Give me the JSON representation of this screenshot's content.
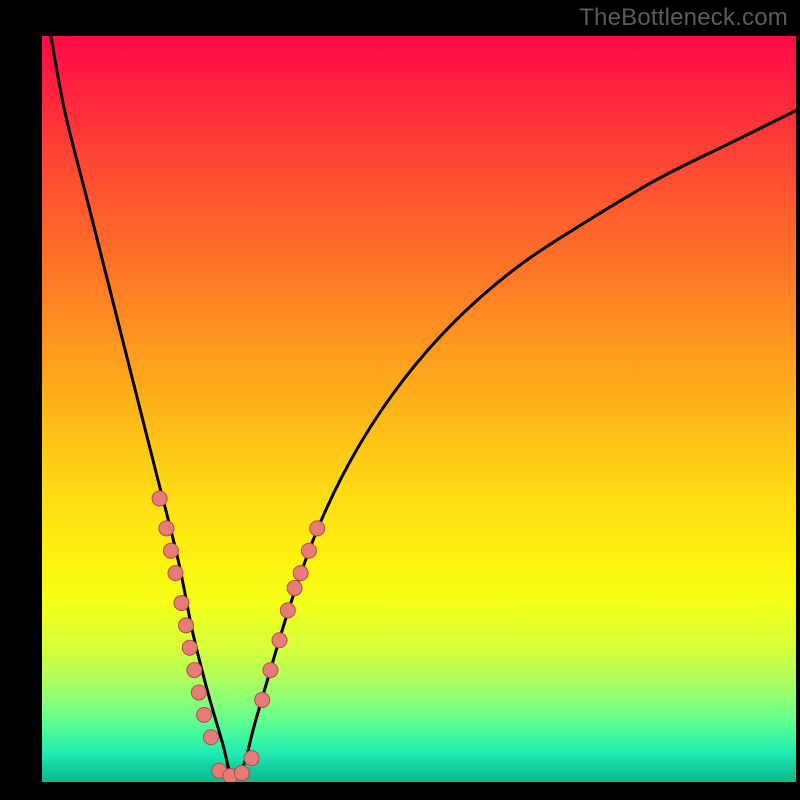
{
  "watermark": "TheBottleneck.com",
  "colors": {
    "frame_bg": "#000000",
    "gradient_top": "#ff0846",
    "gradient_bottom": "#0fb988",
    "curve_stroke": "#000000",
    "dot_fill": "#e77b78",
    "dot_stroke": "#b04e4c",
    "watermark_text": "#5c5c5c"
  },
  "chart_data": {
    "type": "line",
    "title": "",
    "xlabel": "",
    "ylabel": "",
    "xlim": [
      0,
      100
    ],
    "ylim": [
      0,
      100
    ],
    "grid": false,
    "legend": false,
    "notes": "Axes and ticks are not labeled in the source image; x and y are normalized 0–100 to the visible plot area. Vertical gradient background runs from red (y=100) to green (y=0). Curve resembles a sharp V / asymmetric valley with minimum near x≈25, y≈0. Salmon-pink dots are overlaid on the lower flanks of the valley.",
    "series": [
      {
        "name": "curve",
        "x": [
          1,
          3,
          6,
          9,
          12,
          15,
          18,
          20,
          22,
          24,
          25,
          26,
          27,
          28,
          30,
          33,
          37,
          42,
          48,
          55,
          63,
          72,
          82,
          92,
          100
        ],
        "y": [
          101,
          90,
          78,
          66,
          54,
          42,
          30,
          20,
          12,
          5,
          1,
          1,
          3,
          7,
          14,
          24,
          35,
          45,
          54,
          62,
          69,
          75,
          81,
          86,
          90
        ]
      },
      {
        "name": "dots_left_flank",
        "x": [
          15.6,
          16.5,
          17.1,
          17.7,
          18.5,
          19.1,
          19.6,
          20.2,
          20.8,
          21.5,
          22.4
        ],
        "y": [
          38,
          34,
          31,
          28,
          24,
          21,
          18,
          15,
          12,
          9,
          6
        ]
      },
      {
        "name": "dots_bottom",
        "x": [
          23.5,
          25.0,
          26.5,
          27.8
        ],
        "y": [
          1.5,
          0.8,
          1.2,
          3.2
        ]
      },
      {
        "name": "dots_right_flank",
        "x": [
          29.2,
          30.3,
          31.5,
          32.6,
          33.5,
          34.3,
          35.4,
          36.5
        ],
        "y": [
          11,
          15,
          19,
          23,
          26,
          28,
          31,
          34
        ]
      }
    ]
  }
}
